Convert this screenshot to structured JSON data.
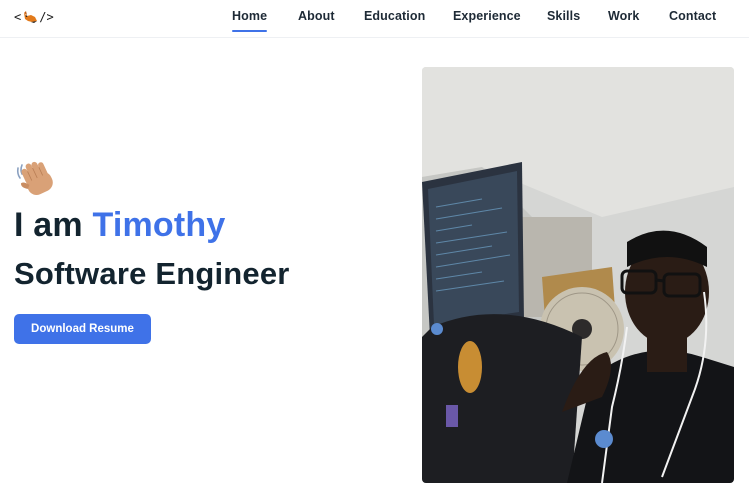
{
  "nav": {
    "logo_left": "<",
    "logo_right": "/>",
    "items": [
      {
        "label": "Home",
        "active": true
      },
      {
        "label": "About",
        "active": false
      },
      {
        "label": "Education",
        "active": false
      },
      {
        "label": "Experience",
        "active": false
      },
      {
        "label": "Skills",
        "active": false
      },
      {
        "label": "Work",
        "active": false
      },
      {
        "label": "Contact",
        "active": false
      }
    ]
  },
  "hero": {
    "greeting_icon": "waving-hand-icon",
    "intro": "I am",
    "name": "Timothy",
    "role": "Software Engineer",
    "cta_label": "Download Resume"
  },
  "colors": {
    "accent": "#3f72e8",
    "text": "#13242f",
    "nav_text": "#1e2a36"
  }
}
